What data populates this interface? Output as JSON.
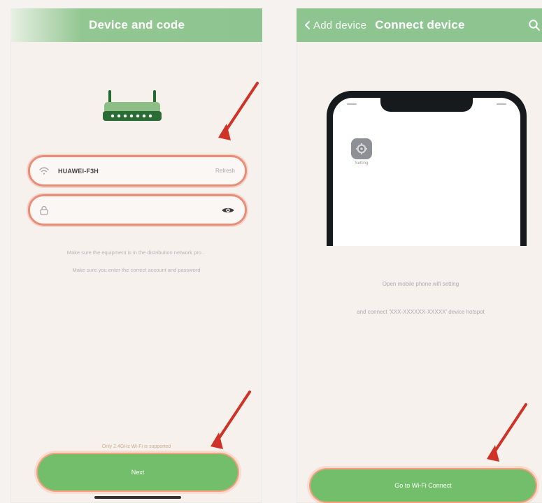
{
  "left_screen": {
    "header_title": "Device and code",
    "ssid_value": "HUAWEI-F3H",
    "ssid_action": "Refresh",
    "hint_1": "Make sure the equipment is in the distribution network pro...",
    "hint_2": "Make sure you enter the correct account and password",
    "support_text": "Only 2.4GHz Wi-Fi is supported",
    "next_button": "Next"
  },
  "right_screen": {
    "back_label": "Add device",
    "header_title": "Connect device",
    "settings_caption": "Setting",
    "text_line_1": "Open mobile phone wifi setting",
    "text_line_2": "and connect 'XXX-XXXXXX-XXXXX' device hotspot",
    "button_label": "Go to Wi-Fi Connect"
  },
  "colors": {
    "accent_green": "#8dc48f",
    "button_green": "#72be6b",
    "outline_coral": "#e88d78",
    "arrow_red": "#cf3328"
  }
}
